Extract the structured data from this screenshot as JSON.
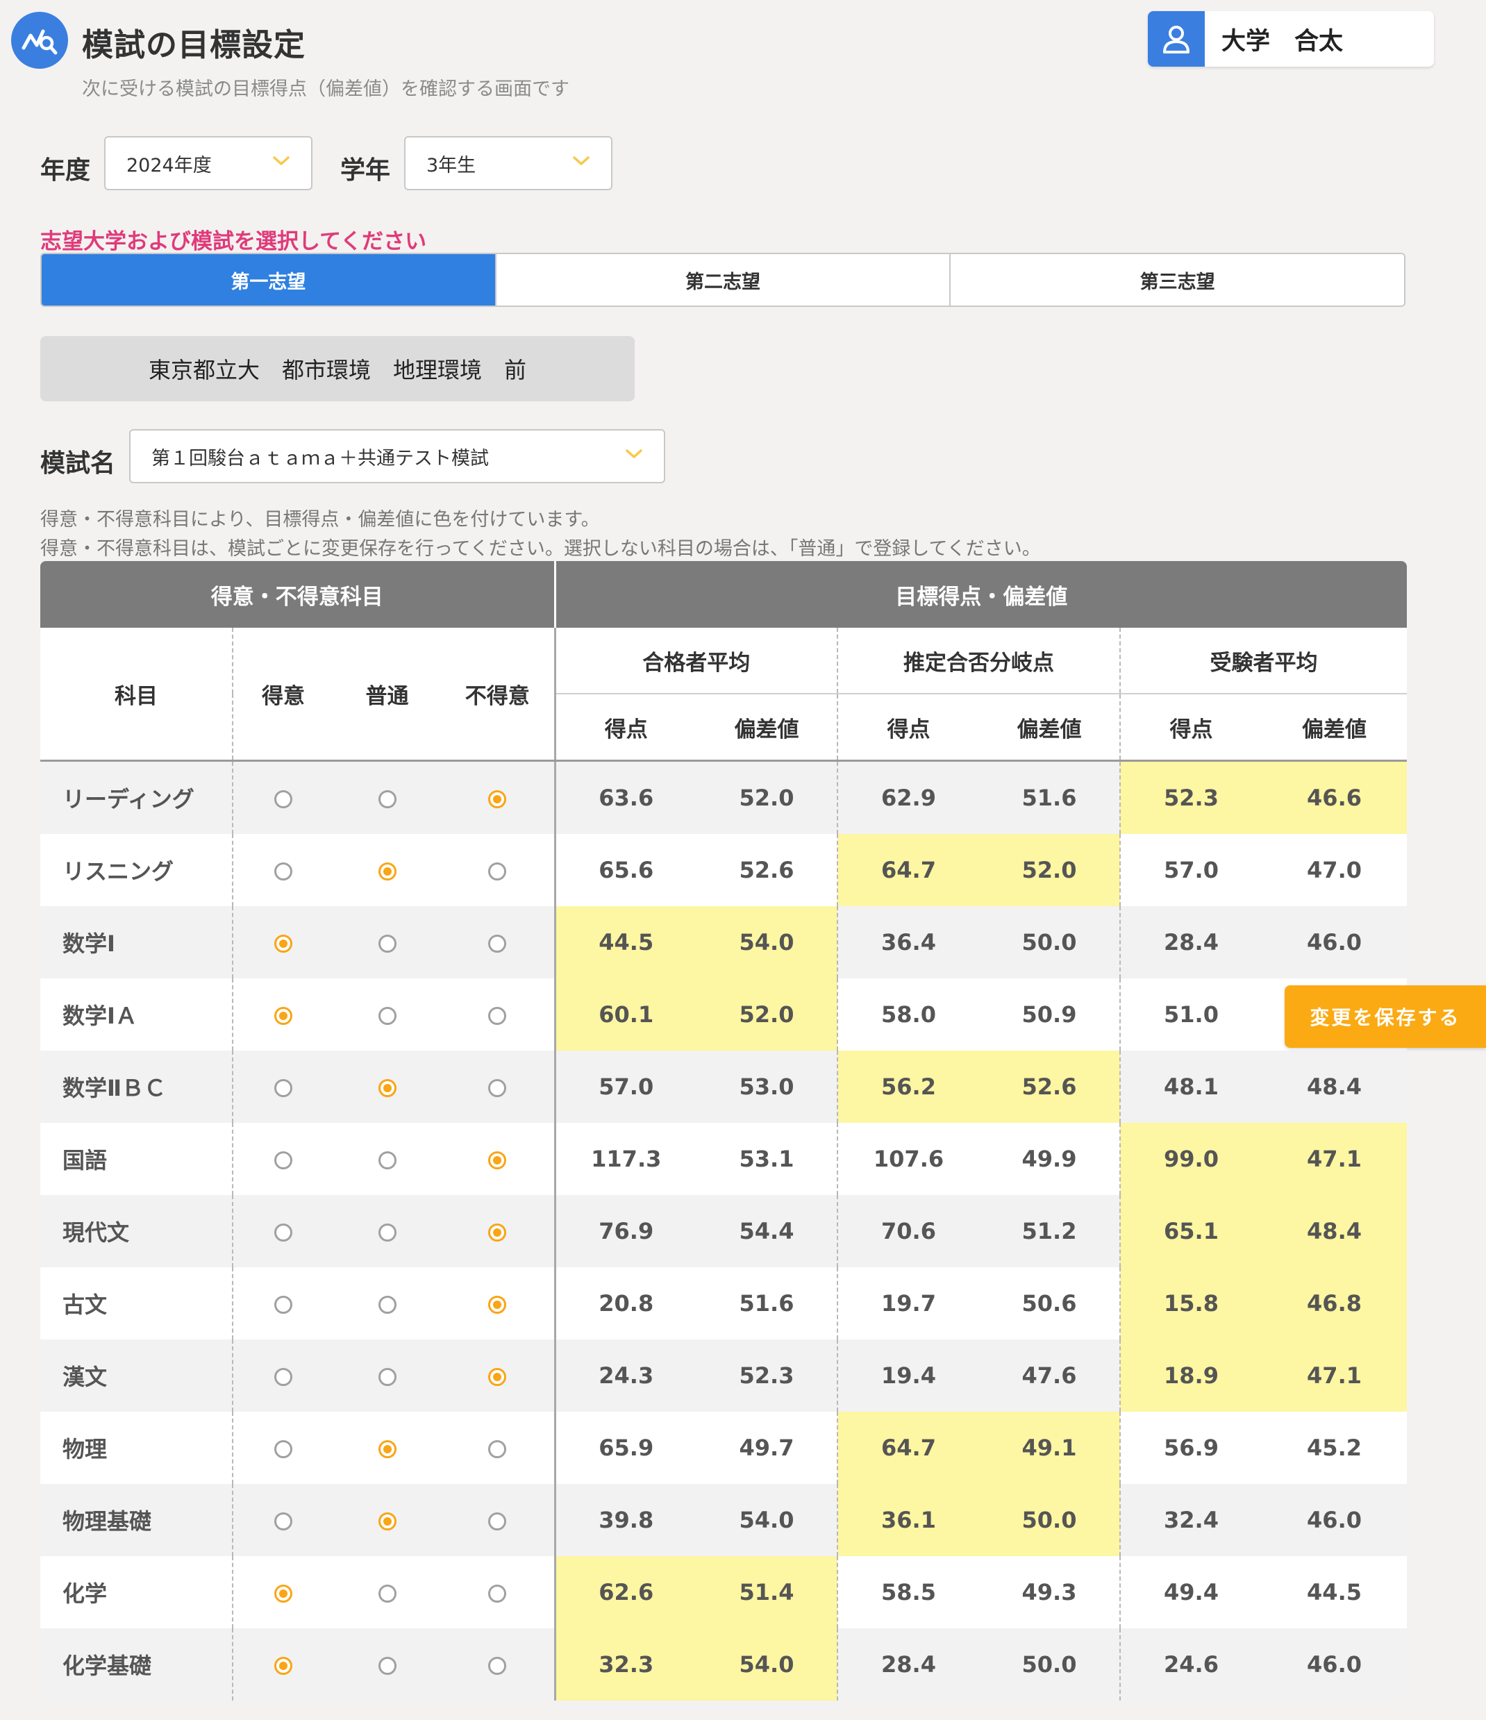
{
  "header": {
    "title": "模試の目標設定",
    "subtitle": "次に受ける模試の目標得点（偏差値）を確認する画面です",
    "user_name": "大学　合太"
  },
  "filters": {
    "year_label": "年度",
    "year_value": "2024年度",
    "grade_label": "学年",
    "grade_value": "3年生"
  },
  "instruction": "志望大学および模試を選択してください",
  "tabs": [
    {
      "label": "第一志望",
      "active": true
    },
    {
      "label": "第二志望",
      "active": false
    },
    {
      "label": "第三志望",
      "active": false
    }
  ],
  "university": [
    "東京都立大",
    "都市環境",
    "地理環境",
    "前"
  ],
  "exam": {
    "label": "模試名",
    "value": "第１回駿台ａｔａｍａ＋共通テスト模試"
  },
  "notes": [
    "得意・不得意科目により、目標得点・偏差値に色を付けています。",
    "得意・不得意科目は、模試ごとに変更保存を行ってください。選択しない科目の場合は、「普通」で登録してください。"
  ],
  "save_button": "変更を保存する",
  "table": {
    "group_pref": "得意・不得意科目",
    "group_target": "目標得点・偏差値",
    "subject_header": "科目",
    "pref_headers": [
      "得意",
      "普通",
      "不得意"
    ],
    "groups": [
      "合格者平均",
      "推定合否分岐点",
      "受験者平均"
    ],
    "score_label": "得点",
    "dev_label": "偏差値",
    "rows": [
      {
        "subject": "リーディング",
        "pref": 2,
        "pass": [
          "63.6",
          "52.0"
        ],
        "border": [
          "62.9",
          "51.6"
        ],
        "all": [
          "52.3",
          "46.6"
        ]
      },
      {
        "subject": "リスニング",
        "pref": 1,
        "pass": [
          "65.6",
          "52.6"
        ],
        "border": [
          "64.7",
          "52.0"
        ],
        "all": [
          "57.0",
          "47.0"
        ]
      },
      {
        "subject": "数学Ⅰ",
        "pref": 0,
        "pass": [
          "44.5",
          "54.0"
        ],
        "border": [
          "36.4",
          "50.0"
        ],
        "all": [
          "28.4",
          "46.0"
        ]
      },
      {
        "subject": "数学ⅠＡ",
        "pref": 0,
        "pass": [
          "60.1",
          "52.0"
        ],
        "border": [
          "58.0",
          "50.9"
        ],
        "all": [
          "51.0",
          ""
        ]
      },
      {
        "subject": "数学ⅡＢＣ",
        "pref": 1,
        "pass": [
          "57.0",
          "53.0"
        ],
        "border": [
          "56.2",
          "52.6"
        ],
        "all": [
          "48.1",
          "48.4"
        ]
      },
      {
        "subject": "国語",
        "pref": 2,
        "pass": [
          "117.3",
          "53.1"
        ],
        "border": [
          "107.6",
          "49.9"
        ],
        "all": [
          "99.0",
          "47.1"
        ]
      },
      {
        "subject": "現代文",
        "pref": 2,
        "pass": [
          "76.9",
          "54.4"
        ],
        "border": [
          "70.6",
          "51.2"
        ],
        "all": [
          "65.1",
          "48.4"
        ]
      },
      {
        "subject": "古文",
        "pref": 2,
        "pass": [
          "20.8",
          "51.6"
        ],
        "border": [
          "19.7",
          "50.6"
        ],
        "all": [
          "15.8",
          "46.8"
        ]
      },
      {
        "subject": "漢文",
        "pref": 2,
        "pass": [
          "24.3",
          "52.3"
        ],
        "border": [
          "19.4",
          "47.6"
        ],
        "all": [
          "18.9",
          "47.1"
        ]
      },
      {
        "subject": "物理",
        "pref": 1,
        "pass": [
          "65.9",
          "49.7"
        ],
        "border": [
          "64.7",
          "49.1"
        ],
        "all": [
          "56.9",
          "45.2"
        ]
      },
      {
        "subject": "物理基礎",
        "pref": 1,
        "pass": [
          "39.8",
          "54.0"
        ],
        "border": [
          "36.1",
          "50.0"
        ],
        "all": [
          "32.4",
          "46.0"
        ]
      },
      {
        "subject": "化学",
        "pref": 0,
        "pass": [
          "62.6",
          "51.4"
        ],
        "border": [
          "58.5",
          "49.3"
        ],
        "all": [
          "49.4",
          "44.5"
        ]
      },
      {
        "subject": "化学基礎",
        "pref": 0,
        "pass": [
          "32.3",
          "54.0"
        ],
        "border": [
          "28.4",
          "50.0"
        ],
        "all": [
          "24.6",
          "46.0"
        ]
      }
    ]
  },
  "colors": {
    "primary": "#2f80e0",
    "accent_orange": "#fbaa14",
    "highlight": "#fdf6a2",
    "instruction": "#e03a7a"
  }
}
